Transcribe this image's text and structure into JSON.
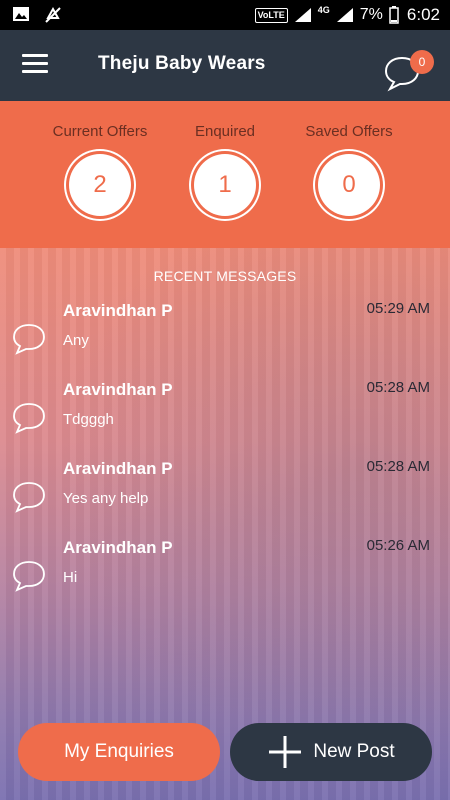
{
  "status_bar": {
    "volte": "VoLTE",
    "network": "4G",
    "battery": "7%",
    "time": "6:02"
  },
  "toolbar": {
    "title": "Theju Baby Wears",
    "chat_badge": "0"
  },
  "stats": [
    {
      "label": "Current Offers",
      "value": "2"
    },
    {
      "label": "Enquired",
      "value": "1"
    },
    {
      "label": "Saved Offers",
      "value": "0"
    }
  ],
  "messages": {
    "title": "RECENT MESSAGES",
    "items": [
      {
        "name": "Aravindhan P",
        "text": "Any",
        "time": "05:29 AM"
      },
      {
        "name": "Aravindhan P",
        "text": "Tdgggh",
        "time": "05:28 AM"
      },
      {
        "name": "Aravindhan P",
        "text": "Yes any help",
        "time": "05:28 AM"
      },
      {
        "name": "Aravindhan P",
        "text": "Hi",
        "time": "05:26 AM"
      }
    ]
  },
  "actions": {
    "enquiries_label": "My Enquiries",
    "new_post_label": "New Post"
  },
  "colors": {
    "accent": "#ef6c4b",
    "toolbar": "#2d3744"
  }
}
